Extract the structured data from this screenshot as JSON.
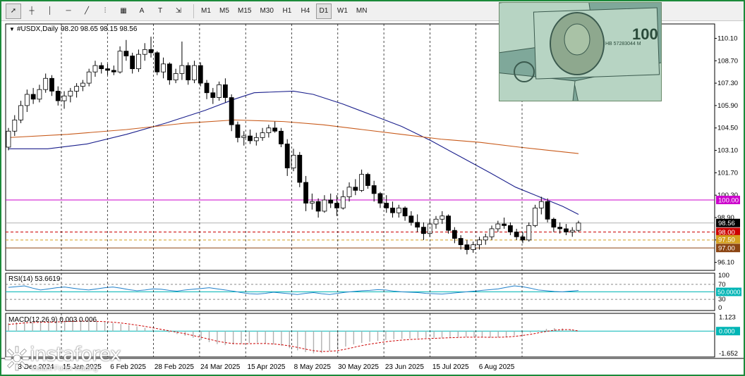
{
  "toolbar": {
    "timeframes": [
      "M1",
      "M5",
      "M15",
      "M30",
      "H1",
      "H4",
      "D1",
      "W1",
      "MN"
    ],
    "active_timeframe": "D1",
    "tools": [
      {
        "name": "cursor-icon",
        "glyph": "➚"
      },
      {
        "name": "crosshair-icon",
        "glyph": "┼"
      },
      {
        "name": "vertical-line-icon",
        "glyph": "│"
      },
      {
        "name": "horizontal-line-icon",
        "glyph": "─"
      },
      {
        "name": "trendline-icon",
        "glyph": "╱"
      },
      {
        "name": "fibonacci-icon",
        "glyph": "⫶"
      },
      {
        "name": "channel-icon",
        "glyph": "▦"
      },
      {
        "name": "text-icon",
        "glyph": "A"
      },
      {
        "name": "text-label-icon",
        "glyph": "T"
      },
      {
        "name": "arrow-shapes-icon",
        "glyph": "⇲"
      }
    ]
  },
  "header": {
    "symbol_label": "#USDX,Daily",
    "ohlc": "98.20 98.65 98.15 98.56"
  },
  "chart_data": [
    {
      "type": "candlestick",
      "title": "#USDX,Daily",
      "x_tick_labels": [
        "3 Dec 2024",
        "15 Jan 2025",
        "6 Feb 2025",
        "28 Feb 2025",
        "24 Mar 2025",
        "15 Apr 2025",
        "8 May 2025",
        "30 May 2025",
        "23 Jun 2025",
        "15 Jul 2025",
        "6 Aug 2025"
      ],
      "y_tick_labels": [
        "110.10",
        "108.70",
        "107.30",
        "105.90",
        "104.50",
        "103.10",
        "101.70",
        "100.30",
        "98.90",
        "97.50",
        "96.10"
      ],
      "ylim": [
        95.6,
        111.0
      ],
      "price_levels": [
        {
          "label": "100.00",
          "value": 100.0,
          "color": "#cc00cc",
          "style": "solid"
        },
        {
          "label": "98.56",
          "value": 98.56,
          "color": "#000000",
          "style": "current"
        },
        {
          "label": "98.00",
          "value": 98.0,
          "color": "#cc0000",
          "style": "dashed"
        },
        {
          "label": "97.50",
          "value": 97.5,
          "color": "#d4a020",
          "style": "dashed"
        },
        {
          "label": "97.00",
          "value": 97.0,
          "color": "#8b4513",
          "style": "solid"
        }
      ],
      "moving_averages": [
        {
          "color": "#1a1f8c",
          "points": [
            [
              0,
              103.2
            ],
            [
              20,
              103.2
            ],
            [
              40,
              103.5
            ],
            [
              60,
              104.1
            ],
            [
              80,
              104.8
            ],
            [
              100,
              105.6
            ],
            [
              115,
              106.3
            ],
            [
              125,
              106.7
            ],
            [
              145,
              106.8
            ],
            [
              155,
              106.6
            ],
            [
              170,
              106.0
            ],
            [
              185,
              105.3
            ],
            [
              200,
              104.6
            ],
            [
              215,
              103.7
            ],
            [
              230,
              102.7
            ],
            [
              245,
              101.7
            ],
            [
              258,
              100.8
            ],
            [
              270,
              100.2
            ],
            [
              282,
              99.6
            ],
            [
              290,
              99.1
            ]
          ]
        },
        {
          "color": "#c85a1a",
          "points": [
            [
              0,
              103.9
            ],
            [
              30,
              104.1
            ],
            [
              60,
              104.4
            ],
            [
              90,
              104.8
            ],
            [
              115,
              105.0
            ],
            [
              140,
              104.9
            ],
            [
              160,
              104.7
            ],
            [
              180,
              104.4
            ],
            [
              200,
              104.1
            ],
            [
              220,
              103.8
            ],
            [
              240,
              103.6
            ],
            [
              260,
              103.3
            ],
            [
              275,
              103.1
            ],
            [
              290,
              102.9
            ]
          ]
        }
      ],
      "candles": [
        [
          103.3,
          104.5,
          103.1,
          104.3
        ],
        [
          104.3,
          105.3,
          104.0,
          105.0
        ],
        [
          105.0,
          106.2,
          104.8,
          105.9
        ],
        [
          105.9,
          106.9,
          105.5,
          106.6
        ],
        [
          106.6,
          107.0,
          106.0,
          106.3
        ],
        [
          106.3,
          107.2,
          106.1,
          106.9
        ],
        [
          106.9,
          107.9,
          106.7,
          107.6
        ],
        [
          107.6,
          107.8,
          106.5,
          106.8
        ],
        [
          106.8,
          107.1,
          105.9,
          106.2
        ],
        [
          106.2,
          106.8,
          105.7,
          106.5
        ],
        [
          106.5,
          107.0,
          106.1,
          106.8
        ],
        [
          106.8,
          107.3,
          106.4,
          107.1
        ],
        [
          107.1,
          107.5,
          106.8,
          107.3
        ],
        [
          107.3,
          108.2,
          107.1,
          108.0
        ],
        [
          108.0,
          108.7,
          107.7,
          108.4
        ],
        [
          108.4,
          108.6,
          107.9,
          108.2
        ],
        [
          108.2,
          108.5,
          107.8,
          108.1
        ],
        [
          108.1,
          108.4,
          107.8,
          108.0
        ],
        [
          108.0,
          109.6,
          107.9,
          109.3
        ],
        [
          109.3,
          110.0,
          108.7,
          109.0
        ],
        [
          109.0,
          109.2,
          107.9,
          108.2
        ],
        [
          108.2,
          109.4,
          108.0,
          109.1
        ],
        [
          109.1,
          109.8,
          108.7,
          109.4
        ],
        [
          109.4,
          110.2,
          108.9,
          109.2
        ],
        [
          109.2,
          109.3,
          107.8,
          108.0
        ],
        [
          108.0,
          108.9,
          107.6,
          108.5
        ],
        [
          108.5,
          108.6,
          107.2,
          107.5
        ],
        [
          107.5,
          108.2,
          107.3,
          107.9
        ],
        [
          107.9,
          109.9,
          107.5,
          108.4
        ],
        [
          108.4,
          108.6,
          107.2,
          107.5
        ],
        [
          107.5,
          108.7,
          107.3,
          108.4
        ],
        [
          108.4,
          108.6,
          107.1,
          107.3
        ],
        [
          107.3,
          107.5,
          106.3,
          106.7
        ],
        [
          106.7,
          107.0,
          106.0,
          106.4
        ],
        [
          106.4,
          107.4,
          106.2,
          107.2
        ],
        [
          107.2,
          107.6,
          106.1,
          106.4
        ],
        [
          106.4,
          106.6,
          104.3,
          104.7
        ],
        [
          104.7,
          104.9,
          103.6,
          103.9
        ],
        [
          103.9,
          104.3,
          103.4,
          104.0
        ],
        [
          104.0,
          104.4,
          103.5,
          103.7
        ],
        [
          103.7,
          104.2,
          103.4,
          103.9
        ],
        [
          103.9,
          104.5,
          103.7,
          104.2
        ],
        [
          104.2,
          104.7,
          103.9,
          104.5
        ],
        [
          104.5,
          104.9,
          104.2,
          104.3
        ],
        [
          104.3,
          104.5,
          103.3,
          103.5
        ],
        [
          103.5,
          103.8,
          101.5,
          102.0
        ],
        [
          102.0,
          103.2,
          101.8,
          102.8
        ],
        [
          102.8,
          103.0,
          100.8,
          101.1
        ],
        [
          101.1,
          101.5,
          99.3,
          99.8
        ],
        [
          99.8,
          100.4,
          99.4,
          99.9
        ],
        [
          99.9,
          100.1,
          98.9,
          99.3
        ],
        [
          99.3,
          100.3,
          99.2,
          100.0
        ],
        [
          100.0,
          100.4,
          99.5,
          99.8
        ],
        [
          99.8,
          100.3,
          99.0,
          99.5
        ],
        [
          99.5,
          100.6,
          99.4,
          100.2
        ],
        [
          100.2,
          101.1,
          99.9,
          100.8
        ],
        [
          100.8,
          101.3,
          100.3,
          100.6
        ],
        [
          100.6,
          101.9,
          100.5,
          101.6
        ],
        [
          101.6,
          101.7,
          100.7,
          100.9
        ],
        [
          100.9,
          101.2,
          99.9,
          100.4
        ],
        [
          100.4,
          100.5,
          99.5,
          99.8
        ],
        [
          99.8,
          100.3,
          99.2,
          99.5
        ],
        [
          99.5,
          99.9,
          98.9,
          99.2
        ],
        [
          99.2,
          99.7,
          98.9,
          99.5
        ],
        [
          99.5,
          99.6,
          98.7,
          99.0
        ],
        [
          99.0,
          99.3,
          98.4,
          98.6
        ],
        [
          98.6,
          99.1,
          98.0,
          98.3
        ],
        [
          98.3,
          98.6,
          97.5,
          97.9
        ],
        [
          97.9,
          98.8,
          97.7,
          98.5
        ],
        [
          98.5,
          99.0,
          98.2,
          98.8
        ],
        [
          98.8,
          99.3,
          98.5,
          99.0
        ],
        [
          99.0,
          99.1,
          97.9,
          98.1
        ],
        [
          98.1,
          98.3,
          97.3,
          97.6
        ],
        [
          97.6,
          97.8,
          96.9,
          97.2
        ],
        [
          97.2,
          97.5,
          96.6,
          96.9
        ],
        [
          96.9,
          97.4,
          96.7,
          97.2
        ],
        [
          97.2,
          97.7,
          96.9,
          97.5
        ],
        [
          97.5,
          97.9,
          97.2,
          97.7
        ],
        [
          97.7,
          98.4,
          97.5,
          98.2
        ],
        [
          98.2,
          98.7,
          98.0,
          98.5
        ],
        [
          98.5,
          98.9,
          98.2,
          98.4
        ],
        [
          98.4,
          98.6,
          97.8,
          98.0
        ],
        [
          98.0,
          98.2,
          97.5,
          97.7
        ],
        [
          97.7,
          98.0,
          97.3,
          97.5
        ],
        [
          97.5,
          98.6,
          97.4,
          98.4
        ],
        [
          98.4,
          99.7,
          98.3,
          99.5
        ],
        [
          99.5,
          100.2,
          99.1,
          99.9
        ],
        [
          99.9,
          100.1,
          98.6,
          98.8
        ],
        [
          98.8,
          98.9,
          98.0,
          98.3
        ],
        [
          98.3,
          98.6,
          97.9,
          98.2
        ],
        [
          98.2,
          98.5,
          97.8,
          98.0
        ],
        [
          98.0,
          98.3,
          97.7,
          98.1
        ],
        [
          98.1,
          98.7,
          98.0,
          98.56
        ]
      ]
    },
    {
      "type": "line",
      "title": "RSI(14) 53.6619",
      "y_tick_labels": [
        "100",
        "70",
        "50.0000",
        "30",
        "0"
      ],
      "ylim": [
        0,
        100
      ],
      "levels": [
        70,
        50,
        30
      ],
      "values": [
        62,
        64,
        66,
        60,
        55,
        58,
        61,
        63,
        60,
        57,
        55,
        58,
        61,
        63,
        60,
        56,
        53,
        55,
        58,
        57,
        54,
        52,
        55,
        57,
        59,
        61,
        58,
        55,
        52,
        48,
        45,
        44,
        46,
        49,
        47,
        45,
        43,
        46,
        48,
        45,
        43,
        46,
        49,
        51,
        53,
        54,
        56,
        55,
        52,
        50,
        49,
        48,
        46,
        45,
        44,
        46,
        48,
        50,
        52,
        54,
        56,
        58,
        62,
        66,
        64,
        60,
        55,
        53,
        51,
        50,
        52,
        53.66
      ]
    },
    {
      "type": "bar",
      "title": "MACD(12,26,9) 0.003 0.006",
      "y_tick_labels": [
        "1.123",
        "0.000",
        "-1.652"
      ],
      "ylim": [
        -1.75,
        1.2
      ],
      "histogram": [
        0.55,
        0.6,
        0.62,
        0.6,
        0.58,
        0.62,
        0.66,
        0.7,
        0.72,
        0.7,
        0.68,
        0.65,
        0.6,
        0.55,
        0.48,
        0.4,
        0.32,
        0.22,
        0.12,
        0.02,
        -0.1,
        -0.2,
        -0.32,
        -0.45,
        -0.6,
        -0.75,
        -0.88,
        -0.95,
        -0.9,
        -0.85,
        -0.8,
        -0.78,
        -0.82,
        -0.9,
        -1.0,
        -1.15,
        -1.3,
        -1.42,
        -1.5,
        -1.48,
        -1.35,
        -1.2,
        -1.05,
        -0.9,
        -0.8,
        -0.72,
        -0.66,
        -0.6,
        -0.55,
        -0.52,
        -0.5,
        -0.48,
        -0.46,
        -0.45,
        -0.44,
        -0.42,
        -0.4,
        -0.38,
        -0.4,
        -0.42,
        -0.45,
        -0.42,
        -0.38,
        -0.3,
        -0.2,
        -0.1,
        0.05,
        0.15,
        0.2,
        0.18,
        0.1,
        0.003
      ],
      "signal": [
        0.45,
        0.5,
        0.55,
        0.58,
        0.6,
        0.6,
        0.62,
        0.64,
        0.66,
        0.67,
        0.67,
        0.66,
        0.64,
        0.6,
        0.55,
        0.48,
        0.4,
        0.32,
        0.22,
        0.12,
        0.02,
        -0.08,
        -0.18,
        -0.3,
        -0.42,
        -0.55,
        -0.68,
        -0.78,
        -0.84,
        -0.86,
        -0.85,
        -0.84,
        -0.84,
        -0.87,
        -0.92,
        -1.0,
        -1.1,
        -1.22,
        -1.32,
        -1.38,
        -1.37,
        -1.32,
        -1.22,
        -1.1,
        -0.98,
        -0.88,
        -0.8,
        -0.72,
        -0.66,
        -0.61,
        -0.57,
        -0.54,
        -0.51,
        -0.49,
        -0.47,
        -0.45,
        -0.43,
        -0.41,
        -0.41,
        -0.41,
        -0.42,
        -0.42,
        -0.4,
        -0.36,
        -0.3,
        -0.22,
        -0.12,
        -0.02,
        0.06,
        0.1,
        0.1,
        0.006
      ]
    }
  ],
  "photo": {
    "serial": "HB 57283044 M",
    "denomination": "100",
    "colors": {
      "bg": "#7fa89a",
      "note": "#b7d4c3",
      "dark": "#3b5a4e",
      "face": "#8ea88e"
    }
  },
  "logo": {
    "brand": "instaforex",
    "tagline": "Instant Forex Trading"
  },
  "colors": {
    "bull_candle": "#ffffff",
    "bear_candle": "#000000",
    "rsi_line": "#1e7fc9",
    "macd_hist": "#b0b0b0",
    "macd_signal": "#cc0000",
    "level_rsi50": "#00b5b5",
    "frame": "#1b8a3a"
  }
}
